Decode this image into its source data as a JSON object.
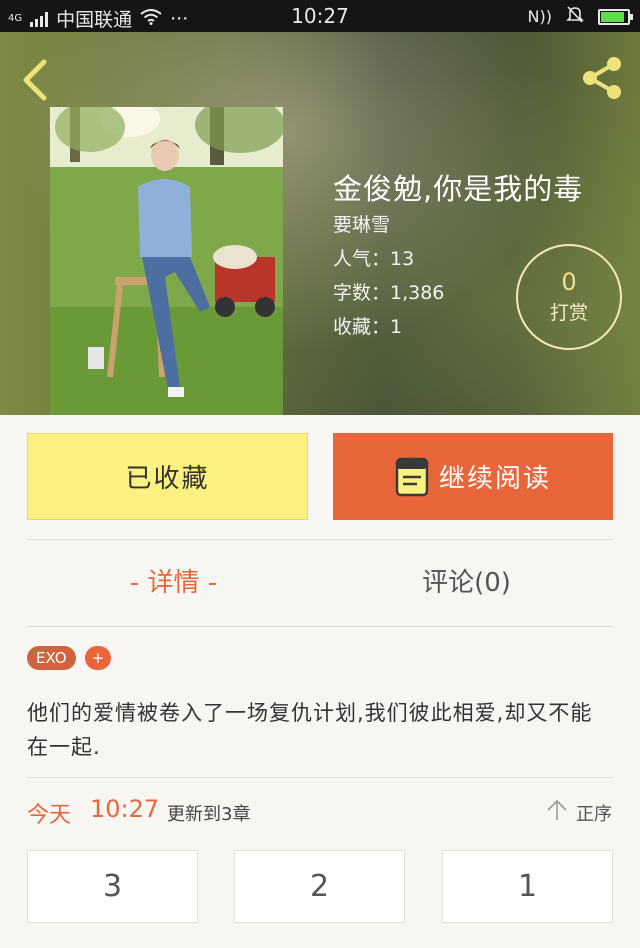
{
  "status_bar": {
    "network_type": "4G",
    "carrier": "中国联通",
    "overflow": "···",
    "time": "10:27",
    "nfc": "N",
    "battery_level": 0.9,
    "icons": [
      "signal-icon",
      "wifi-icon",
      "nfc-icon",
      "mute-bell-icon",
      "battery-charging-icon"
    ]
  },
  "header": {
    "back_icon": "back-chevron-icon",
    "share_icon": "share-icon"
  },
  "book": {
    "title": "金俊勉,你是我的毒",
    "author": "要琳雪",
    "popularity": "人气：13",
    "word_count": "字数：1,386",
    "favorites": "收藏：1",
    "tip_count": "0",
    "tip_label": "打赏"
  },
  "actions": {
    "favorited_label": "已收藏",
    "continue_label": "继续阅读",
    "continue_icon": "book-icon",
    "colors": {
      "favorited_bg": "#fbf180",
      "continue_bg": "#e9663a"
    }
  },
  "tabs": [
    {
      "label": "- 详情 -",
      "active": true
    },
    {
      "label": "评论(0)",
      "active": false
    }
  ],
  "tags": {
    "items": [
      "EXO"
    ],
    "add_label": "+"
  },
  "description": "他们的爱情被卷入了一场复仇计划,我们彼此相爱,却又不能在一起.",
  "update": {
    "day": "今天",
    "time": "10:27",
    "text": "更新到3章",
    "sort_label": "正序",
    "sort_icon": "arrow-up-icon"
  },
  "chapters": [
    "3",
    "2",
    "1"
  ],
  "accent_color": "#e9663a"
}
